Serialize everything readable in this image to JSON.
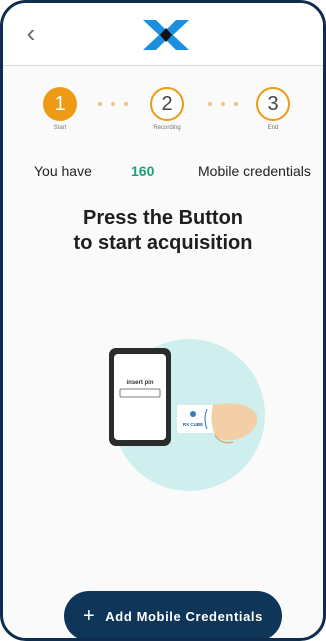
{
  "header": {
    "back_icon": "chevron-left-icon",
    "logo_icon": "brand-logo-icon"
  },
  "stepper": {
    "steps": [
      {
        "number": "1",
        "label": "Start",
        "state": "active"
      },
      {
        "number": "2",
        "label": "Recording",
        "state": "pending"
      },
      {
        "number": "3",
        "label": "End",
        "state": "pending"
      }
    ],
    "accent_color": "#ef9a14"
  },
  "credentials": {
    "prefix": "You have",
    "count": "160",
    "suffix": "Mobile credentials",
    "count_color": "#1ea07a"
  },
  "headline": {
    "line1": "Press the Button",
    "line2": "to start acquisition"
  },
  "illustration": {
    "phone_text": "insert pin",
    "card_text": "RX CUBE"
  },
  "cta": {
    "icon": "plus-icon",
    "label": "Add Mobile Credentials",
    "color": "#0f3559"
  }
}
